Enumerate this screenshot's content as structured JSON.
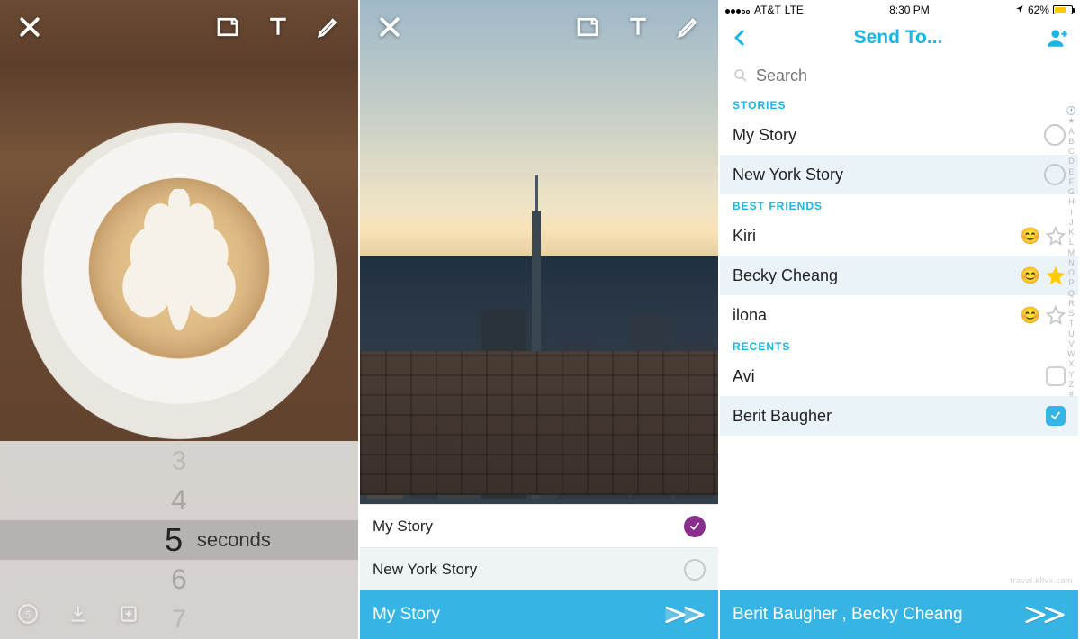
{
  "panel1": {
    "topbar": {
      "close": "close",
      "sticker": "sticker",
      "text": "text",
      "draw": "draw"
    },
    "timer": {
      "values": [
        "3",
        "4",
        "5",
        "6",
        "7"
      ],
      "selected_value": "5",
      "unit": "seconds"
    },
    "bottom_tools": [
      "timer",
      "save",
      "story"
    ]
  },
  "panel2": {
    "topbar": {
      "close": "close",
      "sticker": "sticker",
      "text": "text",
      "draw": "draw"
    },
    "rows": [
      {
        "label": "My Story",
        "checked": true
      },
      {
        "label": "New York Story",
        "checked": false
      }
    ],
    "send_label": "My Story"
  },
  "panel3": {
    "status": {
      "carrier": "AT&T",
      "net": "LTE",
      "time": "8:30 PM",
      "battery": "62%"
    },
    "nav": {
      "title": "Send To..."
    },
    "search": {
      "placeholder": "Search"
    },
    "sections": {
      "stories": {
        "header": "STORIES",
        "items": [
          {
            "label": "My Story",
            "selected": false
          },
          {
            "label": "New York Story",
            "selected": true
          }
        ]
      },
      "bestfriends": {
        "header": "BEST FRIENDS",
        "items": [
          {
            "label": "Kiri",
            "emoji": "😊",
            "star": "gray"
          },
          {
            "label": "Becky Cheang",
            "emoji": "😊",
            "star": "gold",
            "selected": true
          },
          {
            "label": "ilona",
            "emoji": "😊",
            "star": "gray"
          }
        ]
      },
      "recents": {
        "header": "RECENTS",
        "items": [
          {
            "label": "Avi",
            "checked": false
          },
          {
            "label": "Berit Baugher",
            "checked": true,
            "selected": true
          }
        ]
      }
    },
    "send_label": "Berit Baugher , Becky Cheang",
    "index": [
      "🕐",
      "★",
      "A",
      "B",
      "C",
      "D",
      "E",
      "F",
      "G",
      "H",
      "I",
      "J",
      "K",
      "L",
      "M",
      "N",
      "O",
      "P",
      "Q",
      "R",
      "S",
      "T",
      "U",
      "V",
      "W",
      "X",
      "Y",
      "Z",
      "#"
    ],
    "watermark": "travel.kllvx.com"
  }
}
